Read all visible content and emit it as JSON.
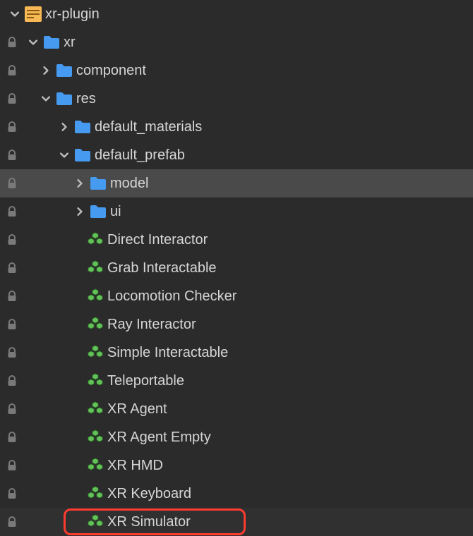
{
  "colors": {
    "folder": "#469af0",
    "prefab": "#63c259",
    "pluginA": "#f7b955",
    "pluginB": "#fce8a8",
    "lock": "#7a7a7a",
    "chevron": "#bdbdbd",
    "highlight": "#ff3b30"
  },
  "tree": {
    "root": {
      "label": "xr-plugin",
      "icon": "plugin",
      "expanded": true,
      "lock": false,
      "indent": 0
    },
    "xr": {
      "label": "xr",
      "icon": "folder",
      "expanded": true,
      "lock": true,
      "indent": 1
    },
    "component": {
      "label": "component",
      "icon": "folder",
      "expanded": false,
      "lock": true,
      "indent": 2
    },
    "res": {
      "label": "res",
      "icon": "folder",
      "expanded": true,
      "lock": true,
      "indent": 2
    },
    "default_materials": {
      "label": "default_materials",
      "icon": "folder",
      "expanded": false,
      "lock": true,
      "indent": 3
    },
    "default_prefab": {
      "label": "default_prefab",
      "icon": "folder",
      "expanded": true,
      "lock": true,
      "indent": 3
    },
    "model": {
      "label": "model",
      "icon": "folder",
      "expanded": false,
      "lock": true,
      "indent": 4,
      "selected": true
    },
    "ui": {
      "label": "ui",
      "icon": "folder",
      "expanded": false,
      "lock": true,
      "indent": 4
    },
    "p1": {
      "label": "Direct Interactor",
      "icon": "prefab",
      "lock": true,
      "indent": 5
    },
    "p2": {
      "label": "Grab Interactable",
      "icon": "prefab",
      "lock": true,
      "indent": 5
    },
    "p3": {
      "label": "Locomotion Checker",
      "icon": "prefab",
      "lock": true,
      "indent": 5
    },
    "p4": {
      "label": "Ray Interactor",
      "icon": "prefab",
      "lock": true,
      "indent": 5
    },
    "p5": {
      "label": "Simple Interactable",
      "icon": "prefab",
      "lock": true,
      "indent": 5
    },
    "p6": {
      "label": "Teleportable",
      "icon": "prefab",
      "lock": true,
      "indent": 5
    },
    "p7": {
      "label": "XR Agent",
      "icon": "prefab",
      "lock": true,
      "indent": 5
    },
    "p8": {
      "label": "XR Agent Empty",
      "icon": "prefab",
      "lock": true,
      "indent": 5
    },
    "p9": {
      "label": "XR HMD",
      "icon": "prefab",
      "lock": true,
      "indent": 5
    },
    "p10": {
      "label": "XR Keyboard",
      "icon": "prefab",
      "lock": true,
      "indent": 5
    },
    "p11": {
      "label": "XR Simulator",
      "icon": "prefab",
      "lock": true,
      "indent": 5,
      "highlighted": true,
      "boxed": true
    }
  }
}
